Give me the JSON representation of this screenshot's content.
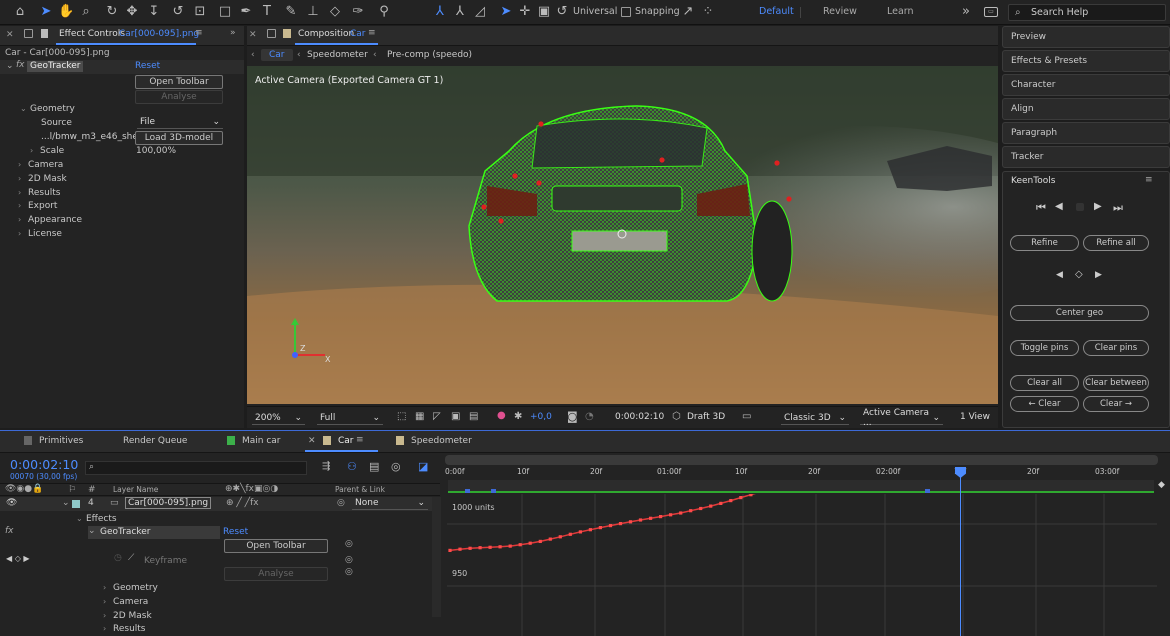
{
  "toolbar": {
    "universal": "Universal",
    "snapping": "Snapping",
    "workspaces": [
      "Default",
      "Review",
      "Learn"
    ],
    "search_help": "Search Help"
  },
  "effect_controls": {
    "title": "Effect Controls",
    "title_file": "Car[000-095].png",
    "layer_path": "Car - Car[000-095].png",
    "effect_name": "GeoTracker",
    "reset": "Reset",
    "open_toolbar": "Open Toolbar",
    "analyse": "Analyse",
    "geometry": "Geometry",
    "source_label": "Source",
    "source_value": "File",
    "model_file": "...l/bmw_m3_e46_shel",
    "load_model": "Load 3D-model",
    "scale_label": "Scale",
    "scale_value": "100,00",
    "scale_unit": "%",
    "sections": [
      "Camera",
      "2D Mask",
      "Results",
      "Export",
      "Appearance",
      "License"
    ]
  },
  "composition": {
    "title": "Composition",
    "title_comp": "Car",
    "breadcrumbs": [
      "Car",
      "Speedometer",
      "Pre-comp (speedo)"
    ],
    "active_camera_label": "Active Camera (Exported Camera GT 1)",
    "footer": {
      "zoom": "200%",
      "resolution": "Full",
      "exposure": "+0,0",
      "timecode": "0:00:02:10",
      "draft": "Draft 3D",
      "renderer": "Classic 3D",
      "camera": "Active Camera ...",
      "views": "1 View"
    }
  },
  "right_panel": {
    "tabs": [
      "Preview",
      "Effects & Presets",
      "Character",
      "Align",
      "Paragraph",
      "Tracker"
    ],
    "keentools_title": "KeenTools",
    "refine": "Refine",
    "refine_all": "Refine all",
    "center_geo": "Center geo",
    "toggle_pins": "Toggle pins",
    "clear_pins": "Clear pins",
    "clear_all": "Clear all",
    "clear_between": "Clear between",
    "clear_left": "← Clear",
    "clear_right": "Clear →"
  },
  "timeline": {
    "tabs": [
      "Primitives",
      "Render Queue",
      "Main car",
      "Car",
      "Speedometer"
    ],
    "active_tab": "Car",
    "current_time": "0:00:02:10",
    "frame_info": "00070 (30,00 fps)",
    "col_hash": "#",
    "col_layer_name": "Layer Name",
    "col_parent": "Parent & Link",
    "layer_number": "4",
    "layer_name": "Car[000-095].png",
    "parent_value": "None",
    "effects": "Effects",
    "effect_name": "GeoTracker",
    "reset": "Reset",
    "open_toolbar": "Open Toolbar",
    "keyframe": "Keyframe",
    "analyse": "Analyse",
    "sections": [
      "Geometry",
      "Camera",
      "2D Mask",
      "Results"
    ],
    "ruler": [
      "0:00f",
      "10f",
      "20f",
      "01:00f",
      "10f",
      "20f",
      "02:00f",
      "10f",
      "20f",
      "03:00f"
    ],
    "graph_labels": [
      "1000 units",
      "950"
    ]
  },
  "colors": {
    "accent": "#4d8cff",
    "graph_curve": "#e03a3a",
    "wireframe": "#39ff14",
    "work_area": "#2fa82f"
  },
  "graph_curve_data": [
    978.7,
    979.7,
    980.4,
    980.9,
    981.2,
    981.6,
    982.2,
    983.3,
    984.5,
    986,
    987.8,
    989.7,
    991.7,
    993.6,
    995.4,
    997.1,
    998.7,
    1000.3,
    1001.8,
    1003.2,
    1004.6,
    1006,
    1007.4,
    1008.9,
    1010.7,
    1012.5,
    1014.4,
    1016.6,
    1018.9,
    1021.3,
    1023.6,
    1026,
    1028.5,
    1031,
    1033.3,
    1035.7,
    1038,
    1040.3,
    1042.6,
    1044.7,
    1046.7,
    1048.9,
    1050.6,
    1052.2,
    1053.8,
    1055.5,
    1057.7,
    1059.8,
    1062.2,
    1064.4,
    1066.2,
    1068.5,
    1070.8,
    1073.3,
    1076.2,
    1078.9,
    1081.4,
    1084.2,
    1086.9,
    1089.7,
    1092.5,
    1095.4,
    1098.3,
    1100.9,
    1103.7,
    1106.5,
    1109.1,
    1111.8,
    1114.6,
    1117.2,
    1119.8
  ]
}
